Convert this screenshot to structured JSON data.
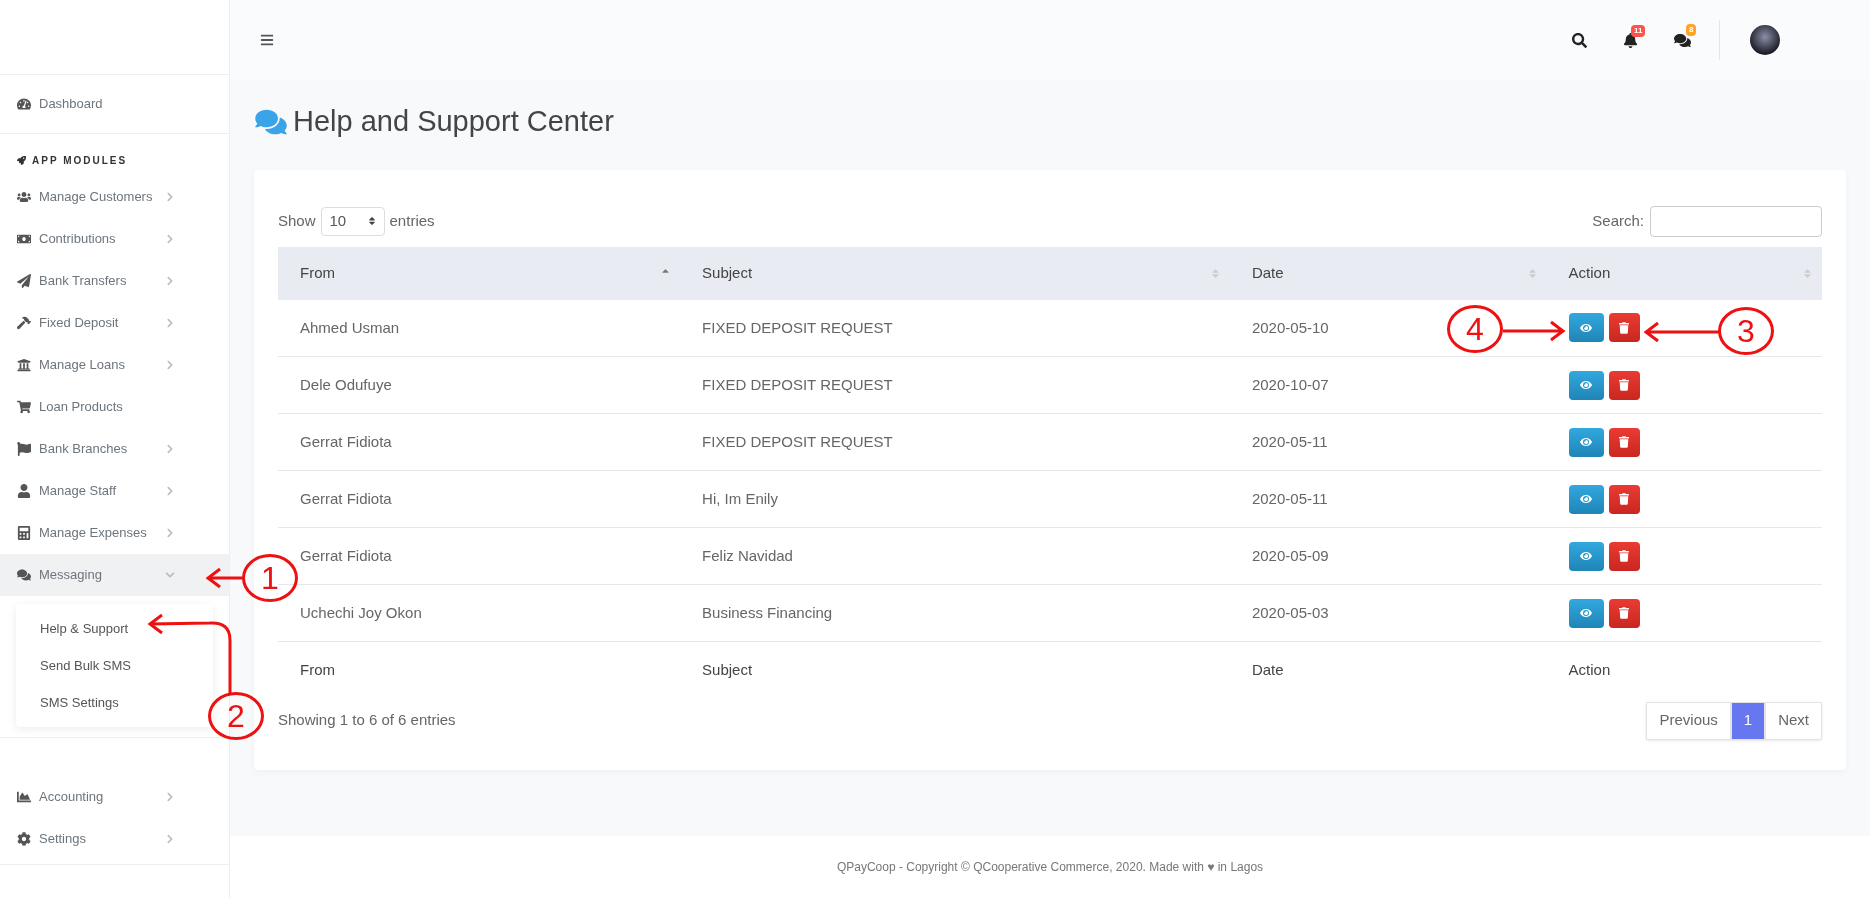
{
  "sidebar": {
    "top": [
      {
        "label": "Dashboard",
        "has_children": false,
        "selected": false
      }
    ],
    "section_title": "APP MODULES",
    "modules": [
      {
        "label": "Manage Customers",
        "has_children": true,
        "expanded": false,
        "selected": false
      },
      {
        "label": "Contributions",
        "has_children": true,
        "expanded": false,
        "selected": false
      },
      {
        "label": "Bank Transfers",
        "has_children": true,
        "expanded": false,
        "selected": false
      },
      {
        "label": "Fixed Deposit",
        "has_children": true,
        "expanded": false,
        "selected": false
      },
      {
        "label": "Manage Loans",
        "has_children": true,
        "expanded": false,
        "selected": false
      },
      {
        "label": "Loan Products",
        "has_children": false,
        "selected": false
      },
      {
        "label": "Bank Branches",
        "has_children": true,
        "expanded": false,
        "selected": false
      },
      {
        "label": "Manage Staff",
        "has_children": true,
        "expanded": false,
        "selected": false
      },
      {
        "label": "Manage Expenses",
        "has_children": true,
        "expanded": false,
        "selected": false
      },
      {
        "label": "Messaging",
        "has_children": true,
        "expanded": true,
        "selected": true,
        "children": [
          {
            "label": "Help & Support"
          },
          {
            "label": "Send Bulk SMS"
          },
          {
            "label": "SMS Settings"
          }
        ]
      }
    ],
    "bottom": [
      {
        "label": "Accounting",
        "has_children": true,
        "expanded": false,
        "selected": false
      },
      {
        "label": "Settings",
        "has_children": true,
        "expanded": false,
        "selected": false
      }
    ]
  },
  "topbar": {
    "notifications_badge": "11",
    "messages_badge": "8"
  },
  "page_title": "Help and Support Center",
  "table_controls": {
    "show_label": "Show",
    "page_size": "10",
    "entries_label": "entries",
    "search_label": "Search:"
  },
  "table": {
    "columns": [
      {
        "label": "From",
        "sorted": true
      },
      {
        "label": "Subject",
        "sorted": false
      },
      {
        "label": "Date",
        "sorted": false
      },
      {
        "label": "Action",
        "sorted": false
      }
    ],
    "rows": [
      {
        "from": "Ahmed Usman",
        "subject": "FIXED DEPOSIT REQUEST",
        "date": "2020-05-10"
      },
      {
        "from": "Dele Odufuye",
        "subject": "FIXED DEPOSIT REQUEST",
        "date": "2020-10-07"
      },
      {
        "from": "Gerrat Fidiota",
        "subject": "FIXED DEPOSIT REQUEST",
        "date": "2020-05-11"
      },
      {
        "from": "Gerrat Fidiota",
        "subject": "Hi, Im Enily",
        "date": "2020-05-11"
      },
      {
        "from": "Gerrat Fidiota",
        "subject": "Feliz Navidad",
        "date": "2020-05-09"
      },
      {
        "from": "Uchechi Joy Okon",
        "subject": "Business Financing",
        "date": "2020-05-03"
      }
    ],
    "footer": [
      "From",
      "Subject",
      "Date",
      "Action"
    ]
  },
  "info": "Showing 1 to 6 of 6 entries",
  "pagination": [
    {
      "label": "Previous",
      "selected": false
    },
    {
      "label": "1",
      "selected": true
    },
    {
      "label": "Next",
      "selected": false
    }
  ],
  "annotations": [
    {
      "label": "1"
    },
    {
      "label": "2"
    },
    {
      "label": "3"
    },
    {
      "label": "4"
    }
  ],
  "footer": "QPayCoop - Copyright © QCooperative Commerce, 2020. Made with ♥ in Lagos"
}
